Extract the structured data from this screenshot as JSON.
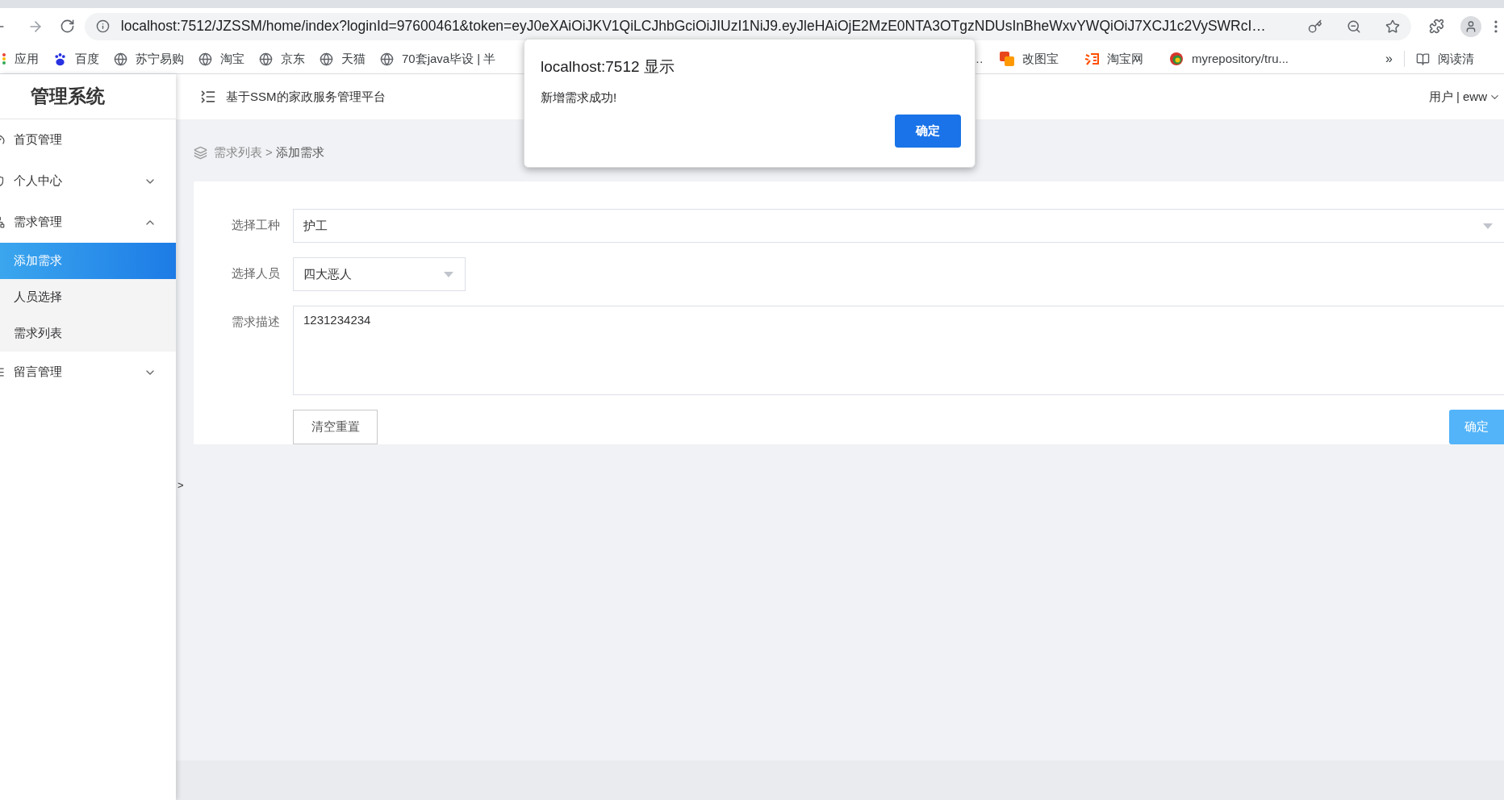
{
  "browser": {
    "url": "localhost:7512/JZSSM/home/index?loginId=97600461&token=eyJ0eXAiOiJKV1QiLCJhbGciOiJIUzI1NiJ9.eyJleHAiOjE2MzE0NTA3OTgzNDUsInBheWxvYWQiOiJ7XCJ1c2VySWRcI…",
    "bookmarks_left": [
      {
        "label": "应用",
        "kind": "apps"
      },
      {
        "label": "百度",
        "kind": "paw"
      },
      {
        "label": "苏宁易购",
        "kind": "globe"
      },
      {
        "label": "淘宝",
        "kind": "globe"
      },
      {
        "label": "京东",
        "kind": "globe"
      },
      {
        "label": "天猫",
        "kind": "globe"
      },
      {
        "label": "70套java毕设 | 半",
        "kind": "globe"
      }
    ],
    "bookmark_hidden": {
      "label": "…"
    },
    "bookmarks_right": [
      {
        "label": "改图宝",
        "kind": "squares"
      },
      {
        "label": "淘宝网",
        "kind": "logo"
      },
      {
        "label": "myrepository/tru...",
        "kind": "ring"
      }
    ],
    "overflow": "»",
    "reading_list": "阅读清"
  },
  "sidebar": {
    "title": "管理系统",
    "items": [
      {
        "label": "首页管理",
        "kind": "link"
      },
      {
        "label": "个人中心",
        "kind": "group",
        "expanded": false
      },
      {
        "label": "需求管理",
        "kind": "group",
        "expanded": true,
        "children": [
          {
            "label": "添加需求",
            "selected": true
          },
          {
            "label": "人员选择",
            "selected": false
          },
          {
            "label": "需求列表",
            "selected": false
          }
        ]
      },
      {
        "label": "留言管理",
        "kind": "group",
        "expanded": false
      }
    ]
  },
  "header": {
    "title": "基于SSM的家政服务管理平台",
    "user": "用户 | eww"
  },
  "breadcrumb": {
    "parent": "需求列表",
    "separator": ">",
    "current": "添加需求"
  },
  "form": {
    "fields": [
      {
        "label": "选择工种",
        "kind": "select",
        "value": "护工"
      },
      {
        "label": "选择人员",
        "kind": "select",
        "value": "四大恶人"
      },
      {
        "label": "需求描述",
        "kind": "textarea",
        "value": "1231234234"
      }
    ],
    "reset_button": "清空重置",
    "submit_button": "确定"
  },
  "collapse_toggle": ">",
  "dialog": {
    "title": "localhost:7512 显示",
    "message": "新增需求成功!",
    "button": "确定"
  }
}
